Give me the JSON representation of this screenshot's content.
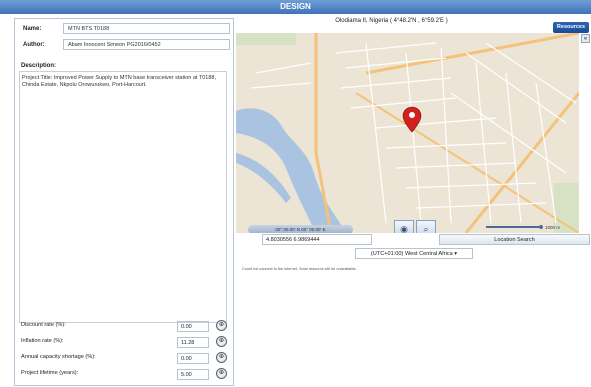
{
  "window": {
    "title": "DESIGN"
  },
  "form": {
    "name_label": "Name:",
    "name_value": "MTN BTS T0188",
    "author_label": "Author:",
    "author_value": "Abam Innocent Simeon PG2016/0452",
    "desc_label": "Description:",
    "desc_value": "Project Title: Improved Power Supply to MTN base transceiver station at T0188, Chinda Estate, Nkpolu Orowurukwo, Port-Harcourt."
  },
  "params": [
    {
      "label": "Discount rate (%):",
      "value": "0.00",
      "icon": "help-icon"
    },
    {
      "label": "Inflation rate (%):",
      "value": "11.28",
      "icon": "help-icon"
    },
    {
      "label": "Annual capacity shortage (%):",
      "value": "0.00",
      "icon": "help-icon"
    },
    {
      "label": "Project lifetime (years):",
      "value": "5.00",
      "icon": "help-icon"
    }
  ],
  "map": {
    "location_title": "Olodiama II, Nigeria ( 4°48.2'N , 6°59.2'E )",
    "resources_label": "Resources",
    "collapse_glyph": "«",
    "coord_readout": "00° 00.00' N 00° 00.00' E",
    "scale_label": "1000 m",
    "latlng_value": "4.8030556 6.9869444",
    "search_label": "Location Search",
    "timezone": "(UTC+01:00) West Central Africa",
    "timezone_note": "Could not connect to the internet. Solar resource will be unavailable.",
    "tools": {
      "view_icon": "eye-icon",
      "zoom_icon": "search-icon"
    },
    "water_color": "#a9c3e0",
    "land_color": "#ece5d5",
    "road_color": "#f4c27b",
    "marker_color": "#d21f1f"
  }
}
